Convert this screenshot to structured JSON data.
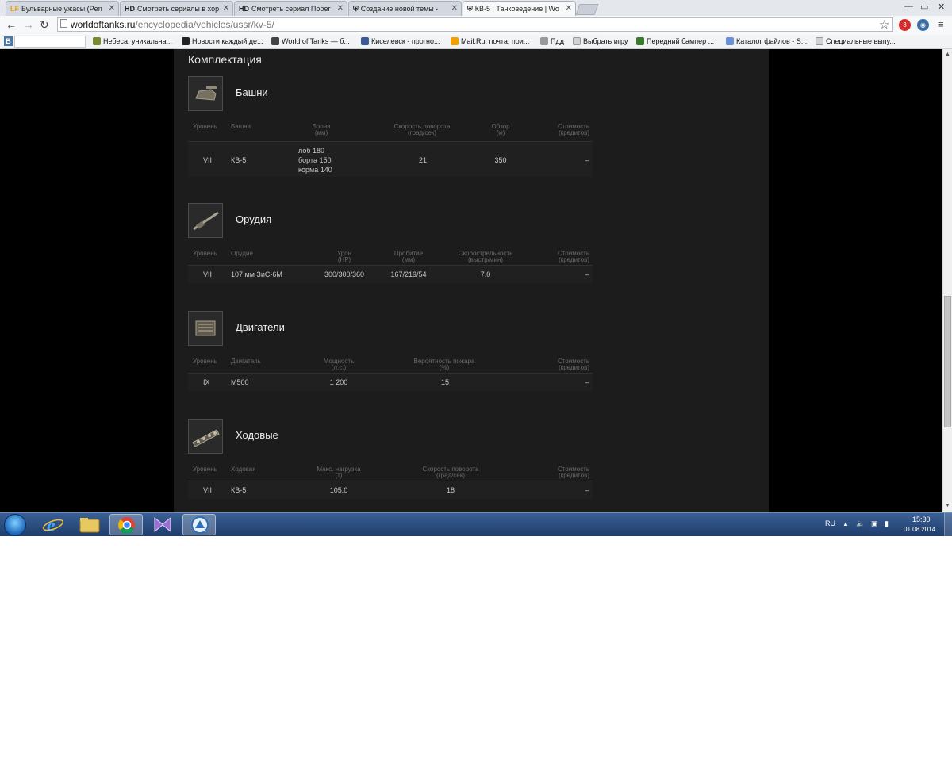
{
  "browser": {
    "tabs": [
      {
        "favicon": "LF",
        "title": "Бульварные ужасы (Pen"
      },
      {
        "favicon": "HD",
        "title": "Смотреть сериалы в хор"
      },
      {
        "favicon": "HD",
        "title": "Смотреть сериал Побег"
      },
      {
        "favicon": "wot-icon",
        "title": "Создание новой темы - "
      },
      {
        "favicon": "wot-icon",
        "title": "КВ-5 | Танковедение | Wo"
      }
    ],
    "url_host": "worldoftanks.ru",
    "url_path": "/encyclopedia/vehicles/ussr/kv-5/",
    "extension_badge": "3",
    "bookmarks": [
      "Небеса: уникальна...",
      "Новости каждый де...",
      "World of Tanks — б...",
      "Киселевск - прогно...",
      "Mail.Ru: почта, пои...",
      "Пдд",
      "Выбрать игру",
      "Передний бампер ...",
      "Каталог файлов - S...",
      "Специальные выпу..."
    ],
    "vk_label": "В"
  },
  "page": {
    "section_title": "Комплектация",
    "turrets": {
      "title": "Башни",
      "headers": {
        "level": "Уровень",
        "name": "Башня",
        "armor": "Броня",
        "armor_unit": "(мм)",
        "traverse": "Скорость поворота",
        "traverse_unit": "(град/сек)",
        "view": "Обзор",
        "view_unit": "(м)",
        "cost": "Стоимость",
        "cost_unit": "(кредитов)"
      },
      "rows": [
        {
          "level": "VII",
          "name": "КВ-5",
          "armor_front": "лоб 180",
          "armor_side": "борта 150",
          "armor_rear": "корма 140",
          "traverse": "21",
          "view": "350",
          "cost": "–"
        }
      ]
    },
    "guns": {
      "title": "Орудия",
      "headers": {
        "level": "Уровень",
        "name": "Орудие",
        "damage": "Урон",
        "damage_unit": "(HP)",
        "penetration": "Пробитие",
        "penetration_unit": "(мм)",
        "rof": "Скорострельность",
        "rof_unit": "(выстр/мин)",
        "cost": "Стоимость",
        "cost_unit": "(кредитов)"
      },
      "rows": [
        {
          "level": "VII",
          "name": "107 мм ЗиС-6М",
          "damage": "300/300/360",
          "penetration": "167/219/54",
          "rof": "7.0",
          "cost": "–"
        }
      ]
    },
    "engines": {
      "title": "Двигатели",
      "headers": {
        "level": "Уровень",
        "name": "Двигатель",
        "power": "Мощность",
        "power_unit": "(л.с.)",
        "fire": "Вероятность пожара",
        "fire_unit": "(%)",
        "cost": "Стоимость",
        "cost_unit": "(кредитов)"
      },
      "rows": [
        {
          "level": "IX",
          "name": "М500",
          "power": "1 200",
          "fire": "15",
          "cost": "–"
        }
      ]
    },
    "suspensions": {
      "title": "Ходовые",
      "headers": {
        "level": "Уровень",
        "name": "Ходовая",
        "load": "Макс. нагрузка",
        "load_unit": "(т)",
        "traverse": "Скорость поворота",
        "traverse_unit": "(град/сек)",
        "cost": "Стоимость",
        "cost_unit": "(кредитов)"
      },
      "rows": [
        {
          "level": "VII",
          "name": "КВ-5",
          "load": "105.0",
          "traverse": "18",
          "cost": "–"
        }
      ]
    }
  },
  "taskbar": {
    "language": "RU",
    "time": "15:30",
    "date": "01.08.2014"
  }
}
